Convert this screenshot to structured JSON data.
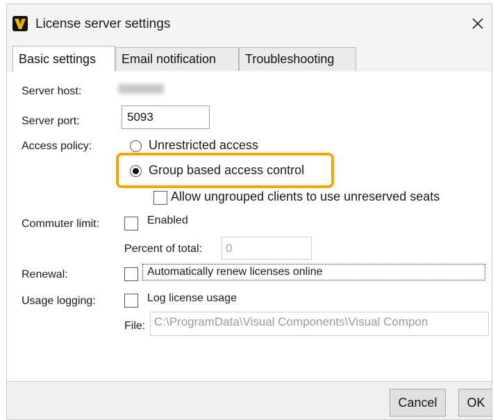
{
  "window": {
    "title": "License server settings",
    "close_icon": "close-icon",
    "logo_icon": "visual-components-logo-icon"
  },
  "tabs": [
    {
      "label": "Basic settings",
      "active": true
    },
    {
      "label": "Email notification",
      "active": false
    },
    {
      "label": "Troubleshooting",
      "active": false
    }
  ],
  "basic": {
    "server_host_label": "Server host:",
    "server_port_label": "Server port:",
    "server_port_value": "5093",
    "access_policy_label": "Access policy:",
    "access_options": [
      {
        "label": "Unrestricted access",
        "selected": false
      },
      {
        "label": "Group based access control",
        "selected": true
      }
    ],
    "ungrouped_label": "Allow ungrouped clients to use unreserved seats",
    "ungrouped_checked": false,
    "commuter_limit_label": "Commuter limit:",
    "commuter_enabled_label": "Enabled",
    "commuter_enabled_checked": false,
    "percent_label": "Percent of total:",
    "percent_value": "0",
    "renewal_label": "Renewal:",
    "renewal_option_label": "Automatically renew licenses online",
    "renewal_checked": false,
    "usage_logging_label": "Usage logging:",
    "log_usage_label": "Log license usage",
    "log_usage_checked": false,
    "file_label": "File:",
    "file_value": "C:\\ProgramData\\Visual Components\\Visual Compon"
  },
  "buttons": {
    "cancel": "Cancel",
    "ok": "OK"
  },
  "colors": {
    "highlight": "#f4a600",
    "logo_yellow": "#f5b800",
    "logo_bg": "#111111"
  }
}
